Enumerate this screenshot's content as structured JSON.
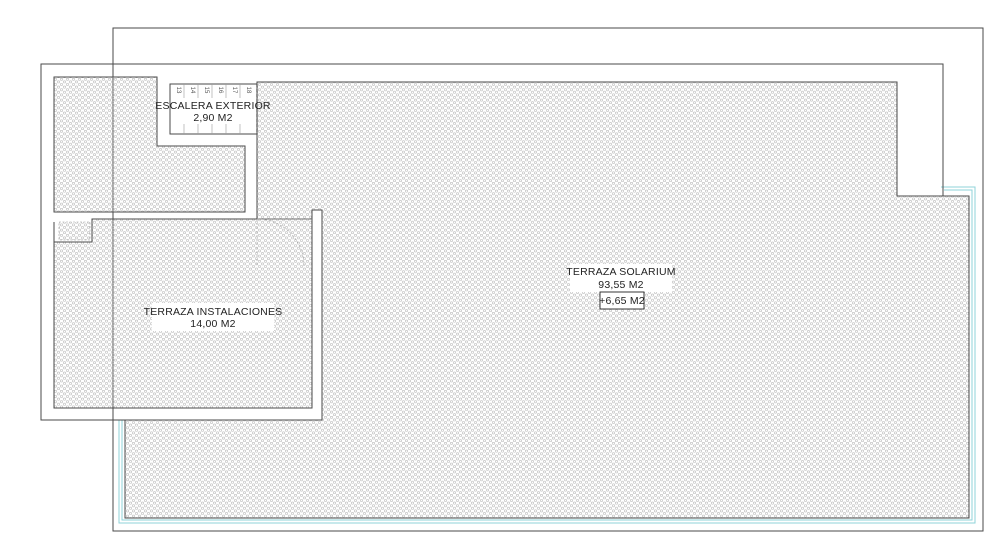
{
  "plan": {
    "rooms": [
      {
        "name": "ESCALERA EXTERIOR",
        "area": "2,90 M2"
      },
      {
        "name": "TERRAZA INSTALACIONES",
        "area": "14,00 M2"
      },
      {
        "name": "TERRAZA SOLARIUM",
        "area": "93,55 M2",
        "extra": "+6,65 M2"
      }
    ],
    "stair_steps": [
      "13",
      "14",
      "15",
      "16",
      "17",
      "18"
    ],
    "colors": {
      "wall": "#4a4a4a",
      "hatch": "#b4b4b4",
      "parapet": "#8fd3da",
      "background": "#ffffff"
    }
  }
}
